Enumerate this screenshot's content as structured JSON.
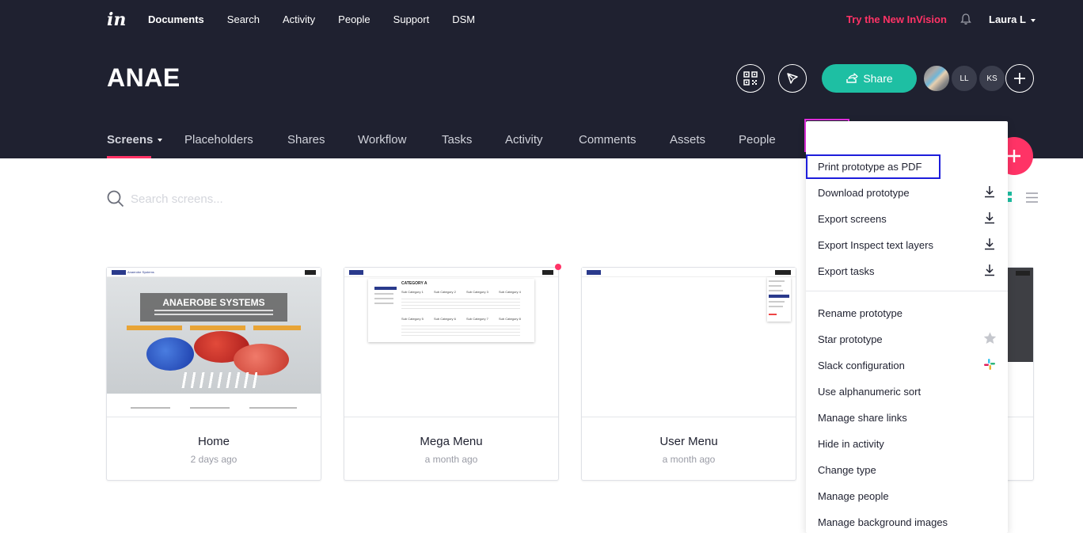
{
  "topnav": {
    "logo": "in",
    "items": [
      "Documents",
      "Search",
      "Activity",
      "People",
      "Support",
      "DSM"
    ],
    "try_new": "Try the New InVision",
    "user": "Laura L"
  },
  "project": {
    "title": "ANAE",
    "share_label": "Share",
    "avatars": [
      "LL",
      "KS"
    ]
  },
  "subnav": {
    "tabs": [
      "Screens",
      "Placeholders",
      "Shares",
      "Workflow",
      "Tasks",
      "Activity",
      "Comments",
      "Assets",
      "People"
    ],
    "more": "•••"
  },
  "search": {
    "placeholder": "Search screens..."
  },
  "cards": [
    {
      "name": "Home",
      "date": "2 days ago"
    },
    {
      "name": "Mega Menu",
      "date": "a month ago"
    },
    {
      "name": "User Menu",
      "date": "a month ago"
    }
  ],
  "thumb_text": {
    "hero_title": "ANAEROBE SYSTEMS",
    "brand": "Anaerobe Systems",
    "category": "CATEGORY A",
    "sub": [
      "Sub Category 1",
      "Sub Category 2",
      "Sub Category 3",
      "Sub Category 4",
      "Sub Category 5",
      "Sub Category 6",
      "Sub Category 7",
      "Sub Category 8"
    ]
  },
  "menu": {
    "items": [
      "Print prototype as PDF",
      "Download prototype",
      "Export screens",
      "Export Inspect text layers",
      "Export tasks",
      "Rename prototype",
      "Star prototype",
      "Slack configuration",
      "Use alphanumeric sort",
      "Manage share links",
      "Hide in activity",
      "Change type",
      "Manage people",
      "Manage background images"
    ]
  },
  "colors": {
    "header_bg": "#1f2130",
    "accent": "#ff3366",
    "share": "#1ebfa3",
    "highlight_more": "#e42ee0",
    "highlight_pdf": "#1d1ddb"
  }
}
